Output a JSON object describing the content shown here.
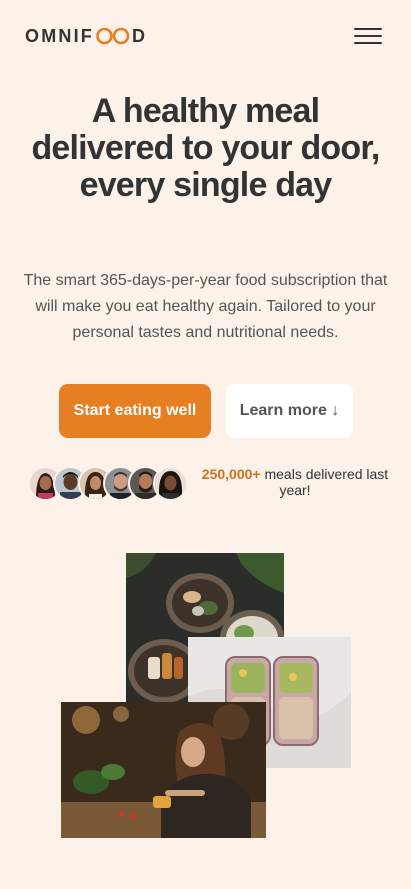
{
  "header": {
    "logo_left": "OMNIF",
    "logo_right": "D",
    "menu_icon": "hamburger-menu-icon"
  },
  "hero": {
    "title": "A healthy meal delivered to your door, every single day",
    "description": "The smart 365-days-per-year food subscription that will make you eat healthy again. Tailored to your personal tastes and nutritional needs.",
    "primary_button": "Start eating well",
    "secondary_button": "Learn more ↓"
  },
  "delivered": {
    "count": "250,000+",
    "text": " meals delivered last year!",
    "avatars": [
      "customer-1",
      "customer-2",
      "customer-3",
      "customer-4",
      "customer-5",
      "customer-6"
    ]
  },
  "images": [
    "bowls-of-food-photo",
    "meal-prep-containers-photo",
    "woman-eating-photo"
  ],
  "colors": {
    "background": "#fdf2e9",
    "accent": "#e67e22",
    "accent_dark": "#cf711f",
    "text": "#333333"
  }
}
